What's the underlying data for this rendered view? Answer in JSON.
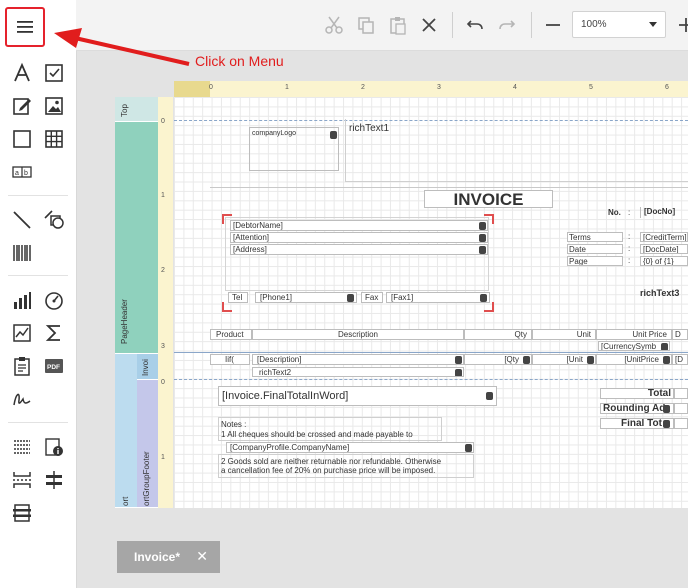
{
  "annotation": {
    "text": "Click on Menu",
    "color": "#e11d1d"
  },
  "toolbar": {
    "zoom_value": "100%"
  },
  "tab": {
    "label": "Invoice*",
    "close": "✕"
  },
  "ruler": {
    "h_ticks": [
      "0",
      "1",
      "2",
      "3",
      "4",
      "5",
      "6"
    ],
    "v_ticks_top": [
      "0"
    ],
    "v_ticks_header": [
      "0",
      "1",
      "2",
      "3"
    ],
    "v_ticks_group": [
      "0",
      "1"
    ]
  },
  "bands": {
    "top": "Top",
    "page_header": "PageHeader",
    "invoice": "Invoi",
    "group_footer": "ortGroupFooter",
    "report": "ort"
  },
  "report": {
    "company_logo": "companyLogo",
    "rich_text1": "richText1",
    "invoice_title": "INVOICE",
    "no_label": "No.",
    "colon": ":",
    "doc_no": "[DocNo]",
    "debtor_name": "[DebtorName]",
    "attention": "[Attention]",
    "address": "[Address]",
    "terms_label": "Terms",
    "terms_value": "[CreditTerm]",
    "date_label": "Date",
    "date_value": "[DocDate]",
    "page_label": "Page",
    "page_value": "{0} of {1}",
    "tel_label": "Tel",
    "phone": "[Phone1]",
    "fax_label": "Fax",
    "fax": "[Fax1]",
    "rich_text3": "richText3",
    "col_product": "Product",
    "col_description": "Description",
    "col_qty": "Qty",
    "col_unit": "Unit",
    "col_unit_price": "Unit Price",
    "col_d": "D",
    "currency_symbol": "[CurrencySymb",
    "detail_iif": "Iif(",
    "detail_description": "[Description]",
    "detail_qty": "[Qty",
    "detail_unit": "[Unit",
    "detail_unit_price": "[UnitPrice",
    "detail_d": "[D",
    "rich_text2": "richText2",
    "final_total_words": "[Invoice.FinalTotalInWord]",
    "total_label": "Total",
    "rounding_label": "Rounding Ad",
    "final_total_label": "Final Tot",
    "notes_title": "Notes :",
    "note1": "1  All cheques should be crossed and made payable to",
    "company_name": "[CompanyProfile.CompanyName]",
    "note2_line1": "2  Goods sold are neither returnable nor refundable. Otherwise",
    "note2_line2": "   a cancellation fee of 20% on purchase price will be imposed."
  }
}
